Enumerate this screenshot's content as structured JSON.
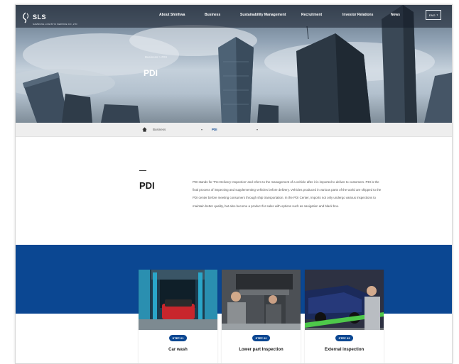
{
  "header": {
    "logo": {
      "mark": "SLS",
      "subtitle": "SAMSUNG LOGISTIC SERVICE CO.,LTD"
    },
    "nav": [
      {
        "label": "About Shinhwa"
      },
      {
        "label": "Business"
      },
      {
        "label": "Sustainability Management"
      },
      {
        "label": "Recruitment"
      },
      {
        "label": "Investor Relations"
      },
      {
        "label": "News"
      }
    ],
    "language": "ENG"
  },
  "hero": {
    "breadcrumb": "Business > PDI",
    "title": "PDI"
  },
  "subnav": {
    "section": "Business",
    "current": "PDI"
  },
  "intro": {
    "title": "PDI",
    "body": "PDI stands for 'Pre-Delivery Inspection' and refers to the management of a vehicle after it is imported to deliver to customers. PDI is the final process of inspecting and supplementing vehicles before delivery. Vehicles produced in various parts of the world are shipped to the PDI center before meeting consumers through ship transportation. In the PDI Center, Imports not only undergo various inspections to maintain better quality, but also become a product for sales with options such as navigation and black box."
  },
  "steps": [
    {
      "step": "STEP 01",
      "label": "Car wash"
    },
    {
      "step": "STEP 02",
      "label": "Lower part Inspection"
    },
    {
      "step": "STEP 03",
      "label": "External inspection"
    }
  ],
  "colors": {
    "brand_blue": "#0b4792",
    "subbar": "#eeeeee"
  },
  "icons": {
    "home": "home-icon",
    "logo": "sls-logo-mark",
    "language": "chevron-down-icon"
  }
}
